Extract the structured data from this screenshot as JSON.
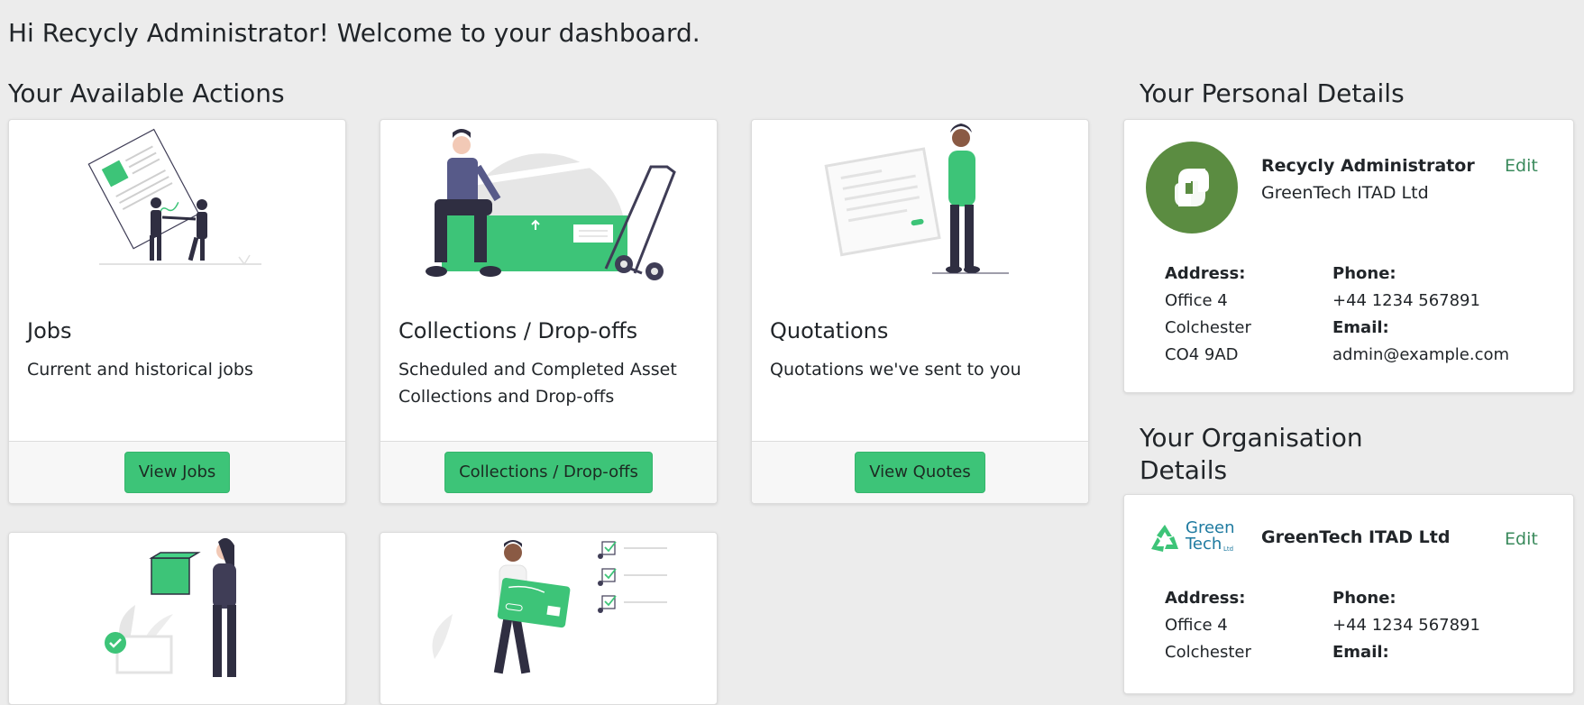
{
  "greeting": "Hi Recycly Administrator! Welcome to your dashboard.",
  "actions_title": "Your Available Actions",
  "personal_title": "Your Personal Details",
  "org_title_line1": "Your Organisation",
  "org_title_line2": "Details",
  "cards": [
    {
      "title": "Jobs",
      "description": "Current and historical jobs",
      "button": "View Jobs"
    },
    {
      "title": "Collections / Drop-offs",
      "description": "Scheduled and Completed Asset Collections and Drop-offs",
      "button": "Collections / Drop-offs"
    },
    {
      "title": "Quotations",
      "description": "Quotations we've sent to you",
      "button": "View Quotes"
    }
  ],
  "personal": {
    "name": "Recycly Administrator",
    "organisation": "GreenTech ITAD Ltd",
    "edit": "Edit",
    "address_label": "Address:",
    "address_line1": "Office 4",
    "address_line2": "Colchester",
    "address_line3": "CO4 9AD",
    "phone_label": "Phone:",
    "phone": "+44 1234 567891",
    "email_label": "Email:",
    "email": "admin@example.com"
  },
  "organisation": {
    "logo_text_line1": "Green",
    "logo_text_line2": "Tech",
    "logo_text_small": "Ltd",
    "name": "GreenTech ITAD Ltd",
    "edit": "Edit",
    "address_label": "Address:",
    "address_line1": "Office 4",
    "address_line2": "Colchester",
    "phone_label": "Phone:",
    "phone": "+44 1234 567891",
    "email_label": "Email:"
  },
  "colors": {
    "accent": "#3dc478",
    "edit_link": "#3a8a5c",
    "logo_green": "#5b8c41",
    "page_bg": "#ececec"
  }
}
